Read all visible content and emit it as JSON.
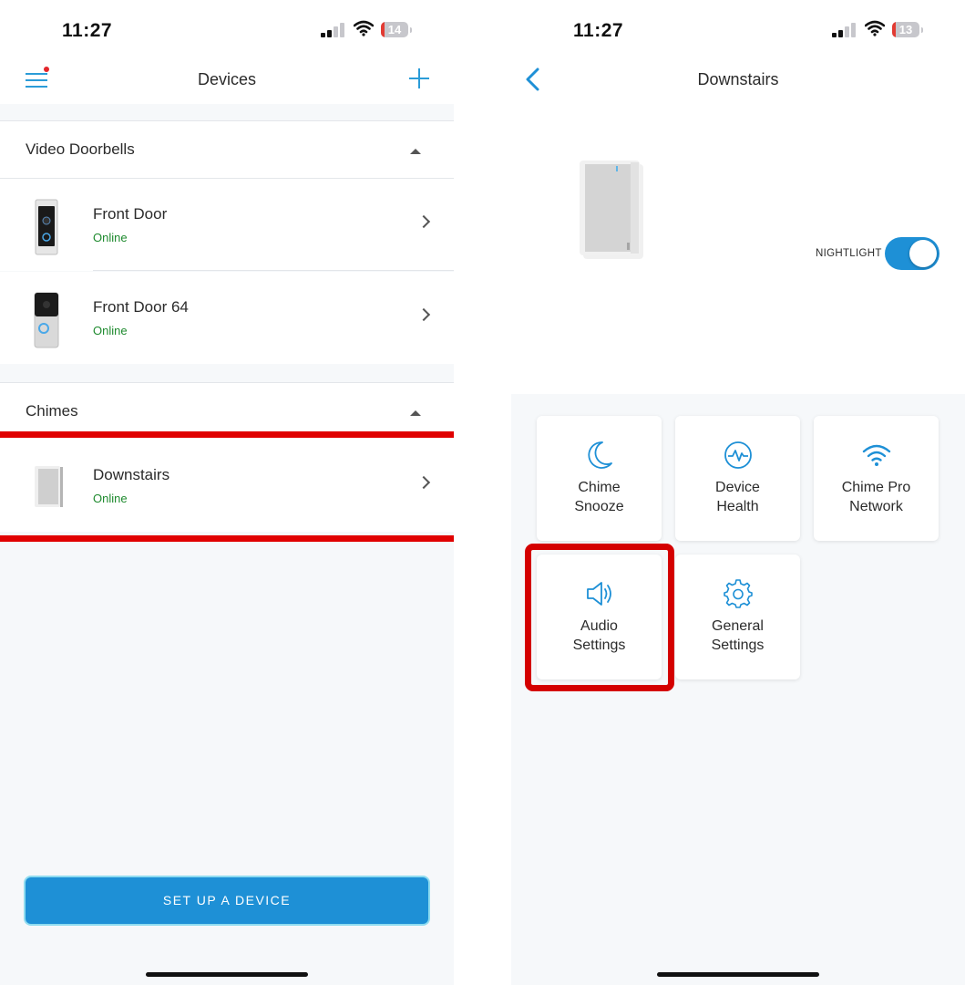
{
  "left": {
    "status_bar": {
      "time": "11:27",
      "battery": "14"
    },
    "nav": {
      "title": "Devices"
    },
    "sections": [
      {
        "title": "Video Doorbells",
        "devices": [
          {
            "name": "Front Door",
            "status": "Online"
          },
          {
            "name": "Front Door 64",
            "status": "Online"
          }
        ]
      },
      {
        "title": "Chimes",
        "devices": [
          {
            "name": "Downstairs",
            "status": "Online"
          }
        ]
      }
    ],
    "setup_button": "SET UP A DEVICE"
  },
  "right": {
    "status_bar": {
      "time": "11:27",
      "battery": "13"
    },
    "nav": {
      "title": "Downstairs"
    },
    "nightlight_label": "NIGHTLIGHT",
    "nightlight_on": true,
    "tiles": [
      {
        "icon": "moon-icon",
        "line1": "Chime",
        "line2": "Snooze"
      },
      {
        "icon": "device-health-icon",
        "line1": "Device",
        "line2": "Health"
      },
      {
        "icon": "wifi-icon",
        "line1": "Chime Pro",
        "line2": "Network"
      },
      {
        "icon": "speaker-icon",
        "line1": "Audio",
        "line2": "Settings"
      },
      {
        "icon": "gear-icon",
        "line1": "General",
        "line2": "Settings"
      }
    ]
  },
  "colors": {
    "accent": "#1e90d6",
    "online": "#1e8a2e",
    "highlight": "#e00000",
    "battery_low": "#e23b33"
  }
}
